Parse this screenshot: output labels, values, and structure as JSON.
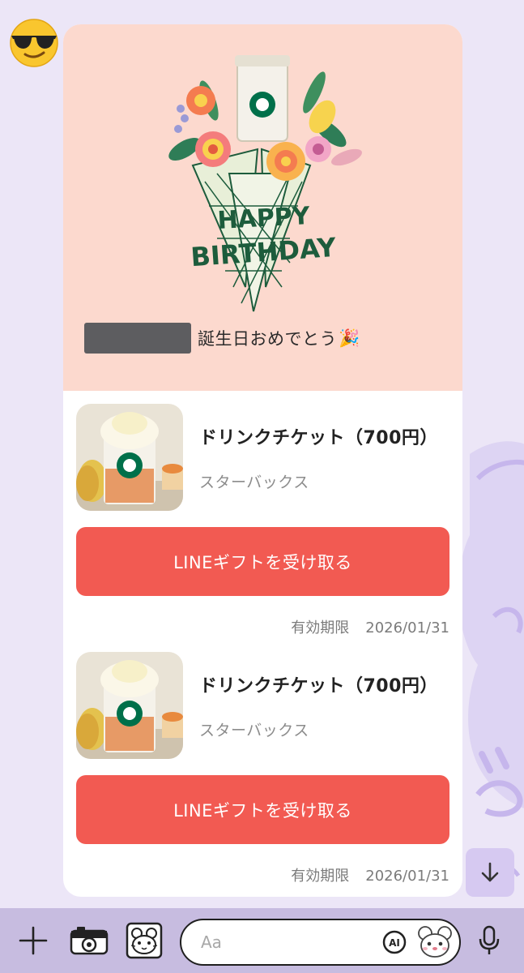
{
  "chat": {
    "message_text": "誕生日おめでとう",
    "message_emoji": "🎉",
    "greeting_card_text": [
      "HAPPY",
      "BIRTHDAY"
    ]
  },
  "gifts": [
    {
      "title": "ドリンクチケット（700円）",
      "brand": "スターバックス",
      "button_label": "LINEギフトを受け取る",
      "expiry_label": "有効期限",
      "expiry_date": "2026/01/31"
    },
    {
      "title": "ドリンクチケット（700円）",
      "brand": "スターバックス",
      "button_label": "LINEギフトを受け取る",
      "expiry_label": "有効期限",
      "expiry_date": "2026/01/31"
    }
  ],
  "input": {
    "placeholder": "Aa",
    "ai_label": "AI"
  },
  "icons": {
    "avatar": "sunglasses-emoji-icon",
    "plus": "plus-icon",
    "camera": "camera-icon",
    "sticker": "sticker-icon",
    "mic": "microphone-icon",
    "scroll": "arrow-down-icon"
  },
  "colors": {
    "accent": "#F25A52",
    "header_bg": "#FCD9CE",
    "chat_bg": "#ECE6F7",
    "bar_bg": "#C7BCE0",
    "starbucks_green": "#00704A"
  }
}
